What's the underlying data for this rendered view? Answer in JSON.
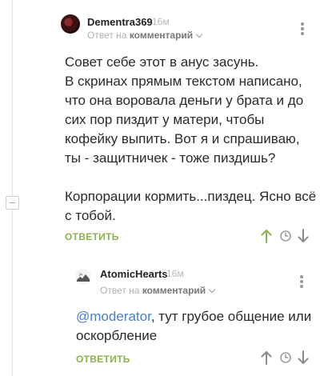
{
  "comments": [
    {
      "username": "Dementra369",
      "time": "16м",
      "reply_prefix": "Ответ на",
      "reply_target": "комментарий",
      "text": "Совет себе этот в анус засунь.\nВ скринах прямым текстом написано, что она воровала деньги у брата и до сих пор пиздит у матери, чтобы кофейку выпить. Вот я и спрашиваю, ты - защитничек - тоже пиздишь?\n\nКорпорации кормить...пиздец. Ясно всё с тобой.",
      "reply_label": "ОТВЕТИТЬ"
    },
    {
      "username": "AtomicHearts",
      "time": "16м",
      "reply_prefix": "Ответ на",
      "reply_target": "комментарий",
      "mention": "@moderator",
      "text": ",  тут грубое общение или оскорбление",
      "reply_label": "ОТВЕТИТЬ"
    }
  ],
  "colors": {
    "accent_green": "#8ab14e",
    "mention_blue": "#4a7fc1",
    "muted": "#b0b0b0"
  },
  "icons": [
    "arrow-up-icon",
    "clock-icon",
    "arrow-down-icon",
    "more-vertical-icon",
    "chevron-down-icon",
    "collapse-icon"
  ]
}
